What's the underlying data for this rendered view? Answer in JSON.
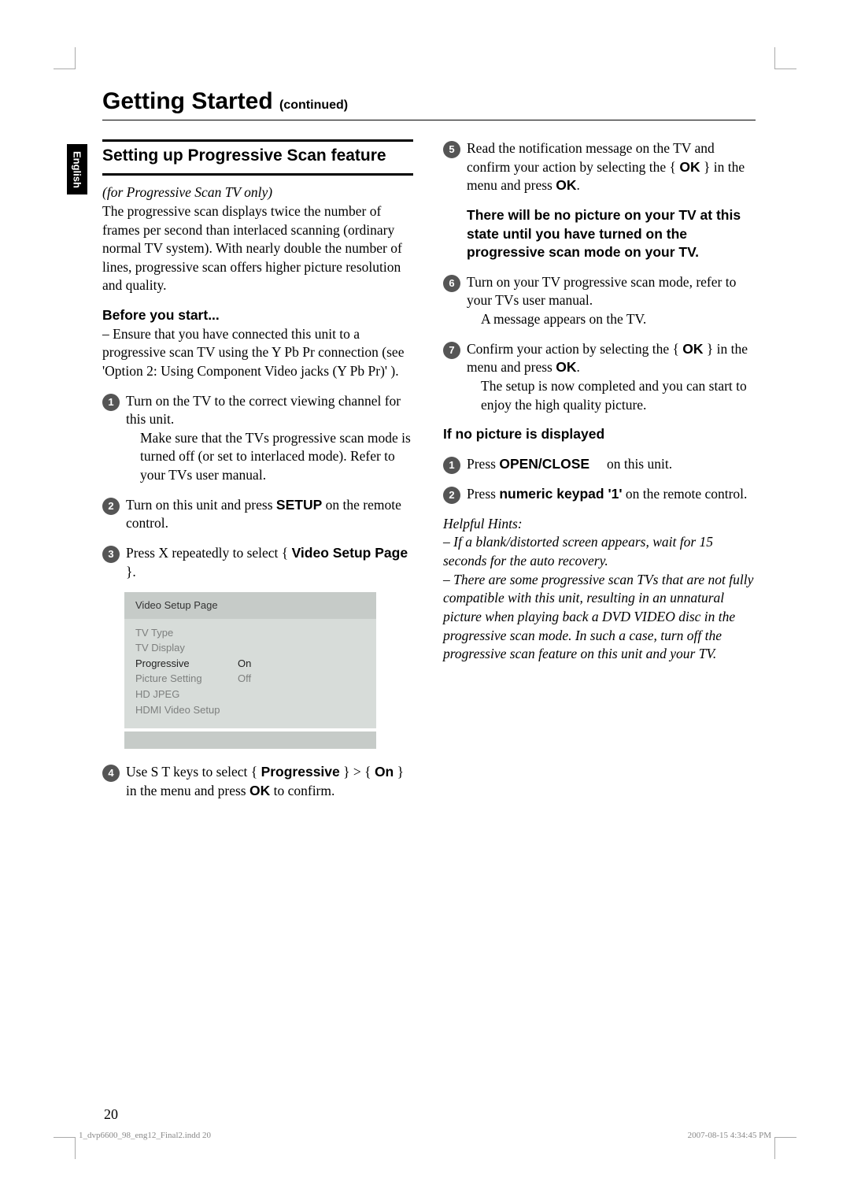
{
  "language_tab": "English",
  "page_title_main": "Getting Started",
  "page_title_cont": "(continued)",
  "section_title": "Setting up Progressive Scan feature",
  "intro_italic": "(for Progressive Scan TV only)",
  "intro_body": "The progressive scan displays twice the number of frames per second than interlaced scanning (ordinary normal TV system). With nearly double the number of lines, progressive scan offers higher picture resolution and quality.",
  "before_heading": "Before you start...",
  "before_body": "–  Ensure that you have connected this unit to a progressive scan TV using the Y Pb Pr connection (see 'Option 2: Using Component Video jacks (Y Pb Pr)' ).",
  "left_steps": {
    "s1_a": "Turn on the TV to the correct viewing channel for this unit.",
    "s1_b": "Make sure that the TVs progressive scan mode is turned off (or set to interlaced mode). Refer to your TVs user manual.",
    "s2_a": "Turn on this unit and press ",
    "s2_b": "SETUP",
    "s2_c": " on the remote control.",
    "s3_a": "Press  X repeatedly to select { ",
    "s3_b": "Video Setup Page",
    "s3_c": " }.",
    "s4_a": "Use  S T keys to select { ",
    "s4_b": "Progressive",
    "s4_c": " } > { ",
    "s4_d": "On",
    "s4_e": " } in the menu and press ",
    "s4_f": "OK",
    "s4_g": " to confirm."
  },
  "menu": {
    "header": "Video Setup Page",
    "rows": [
      {
        "left": "TV Type",
        "right": ""
      },
      {
        "left": "TV Display",
        "right": ""
      },
      {
        "left": "Progressive",
        "right": "On",
        "hl": true
      },
      {
        "left": "Picture Setting",
        "right": "Off"
      },
      {
        "left": "HD JPEG",
        "right": ""
      },
      {
        "left": "HDMI Video Setup",
        "right": ""
      }
    ]
  },
  "right_steps": {
    "s5_a": "Read the notification message on the TV and confirm your action by selecting the { ",
    "s5_b": "OK",
    "s5_c": " } in the menu and press ",
    "s5_d": "OK",
    "s5_e": ".",
    "warn": "There will be no picture on your TV at this state until you have turned on the progressive scan mode on your TV.",
    "s6_a": "Turn on your TV progressive scan mode, refer to your TVs user manual.",
    "s6_b": "A message appears on the TV.",
    "s7_a": "Confirm your action by selecting the { ",
    "s7_b": "OK",
    "s7_c": " } in the menu and press ",
    "s7_d": "OK",
    "s7_e": ".",
    "s7_f": "The setup is now completed and you can start to enjoy the high quality picture."
  },
  "no_pic_heading": "If no picture is displayed",
  "no_pic": {
    "s1_a": "Press ",
    "s1_b": "OPEN/CLOSE",
    "s1_c": " on this unit.",
    "s2_a": "Press ",
    "s2_b": "numeric keypad '1'",
    "s2_c": " on the remote control."
  },
  "hints_heading": "Helpful Hints:",
  "hints_1": "–  If a blank/distorted screen appears, wait for 15 seconds for the auto recovery.",
  "hints_2": "–  There are some progressive scan TVs that are not fully compatible with this unit, resulting in an unnatural picture when playing back a DVD VIDEO disc in the progressive scan mode. In such a case, turn off the progressive scan feature on this unit and your TV.",
  "page_number": "20",
  "footer_left": "1_dvp6600_98_eng12_Final2.indd   20",
  "footer_right": "2007-08-15   4:34:45 PM"
}
